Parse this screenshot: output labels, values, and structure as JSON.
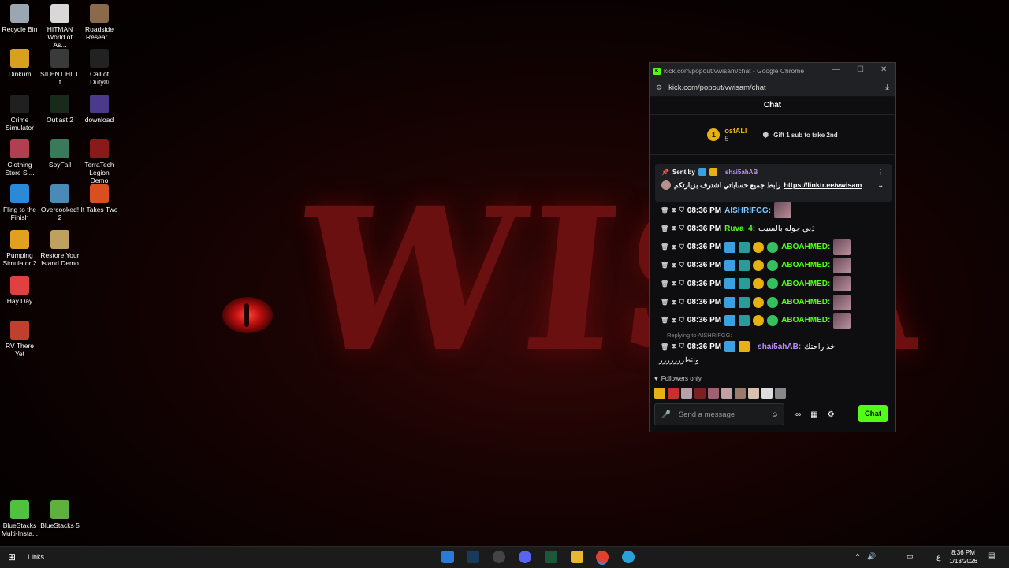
{
  "wallpaper": {
    "text": "WISA"
  },
  "desktop_icons": [
    {
      "label": "Recycle Bin",
      "color": "#9aa7b2"
    },
    {
      "label": "HITMAN World of As...",
      "color": "#d8d8d8"
    },
    {
      "label": "Roadside Resear...",
      "color": "#8a6a4a"
    },
    {
      "label": "Dinkum",
      "color": "#d8a020"
    },
    {
      "label": "SILENT HILL f",
      "color": "#3a3a3a"
    },
    {
      "label": "Call of Duty®",
      "color": "#222222"
    },
    {
      "label": "Crime Simulator",
      "color": "#202020"
    },
    {
      "label": "Outlast 2",
      "color": "#1a2a1a"
    },
    {
      "label": "download",
      "color": "#4a3a8a"
    },
    {
      "label": "Clothing Store Si...",
      "color": "#b04050"
    },
    {
      "label": "SpyFall",
      "color": "#3a7a5a"
    },
    {
      "label": "TerraTech Legion Demo",
      "color": "#8a1a1a"
    },
    {
      "label": "Fling to the Finish",
      "color": "#2a8ad8"
    },
    {
      "label": "Overcooked! 2",
      "color": "#4a8ab8"
    },
    {
      "label": "It Takes Two",
      "color": "#d85020"
    },
    {
      "label": "Pumping Simulator 2",
      "color": "#e0a020"
    },
    {
      "label": "Restore Your Island Demo",
      "color": "#c0a060"
    },
    {
      "label": "Hay Day",
      "color": "#e04040"
    },
    {
      "label": "RV There Yet",
      "color": "#c04030"
    },
    {
      "label": "BlueStacks Multi-Insta...",
      "color": "#50c040"
    },
    {
      "label": "BlueStacks 5",
      "color": "#60b040"
    }
  ],
  "window": {
    "title": "kick.com/popout/vwisam/chat - Google Chrome",
    "url": "kick.com/popout/vwisam/chat",
    "minimize": "—",
    "maximize": "☐",
    "close": "✕"
  },
  "chat": {
    "header": "Chat",
    "leader_rank": "1",
    "leader_name": "osfALI",
    "leader_count": "5",
    "gift_text": "Gift 1 sub to take 2nd",
    "pinned_sent_by": "Sent by",
    "pinned_user": "shai5ahAB",
    "pinned_text": "رابط جميع حساباتي اشترف بزيارتكم",
    "pinned_link": "https://linktr.ee/vwisam",
    "messages": [
      {
        "time": "08:36 PM",
        "user": "AISHRIFGG:",
        "text": "",
        "color": "#7fc8ff",
        "emote": true
      },
      {
        "time": "08:36 PM",
        "user": "Ruva_4:",
        "text": "ذبي جوله بالسيت",
        "color": "#53fc18",
        "emote": false
      },
      {
        "time": "08:36 PM",
        "user": "ABOAHMED:",
        "text": "",
        "color": "#53fc18",
        "emote": true
      },
      {
        "time": "08:36 PM",
        "user": "ABOAHMED:",
        "text": "",
        "color": "#53fc18",
        "emote": true
      },
      {
        "time": "08:36 PM",
        "user": "ABOAHMED:",
        "text": "",
        "color": "#53fc18",
        "emote": true
      },
      {
        "time": "08:36 PM",
        "user": "ABOAHMED:",
        "text": "",
        "color": "#53fc18",
        "emote": true
      },
      {
        "time": "08:36 PM",
        "user": "ABOAHMED:",
        "text": "",
        "color": "#53fc18",
        "emote": true
      }
    ],
    "reply_to": "Replying to AISHRIFGG:",
    "reply_time": "08:36 PM",
    "reply_user": "shai5ahAB:",
    "reply_text": "خذ راحتك",
    "reply_text2": "وننطررررررر",
    "followers_only": "Followers only",
    "send_placeholder": "Send a message",
    "chat_button": "Chat"
  },
  "taskbar": {
    "links": "Links",
    "time": "8:36 PM",
    "date": "1/13/2026",
    "lang": "ع"
  }
}
